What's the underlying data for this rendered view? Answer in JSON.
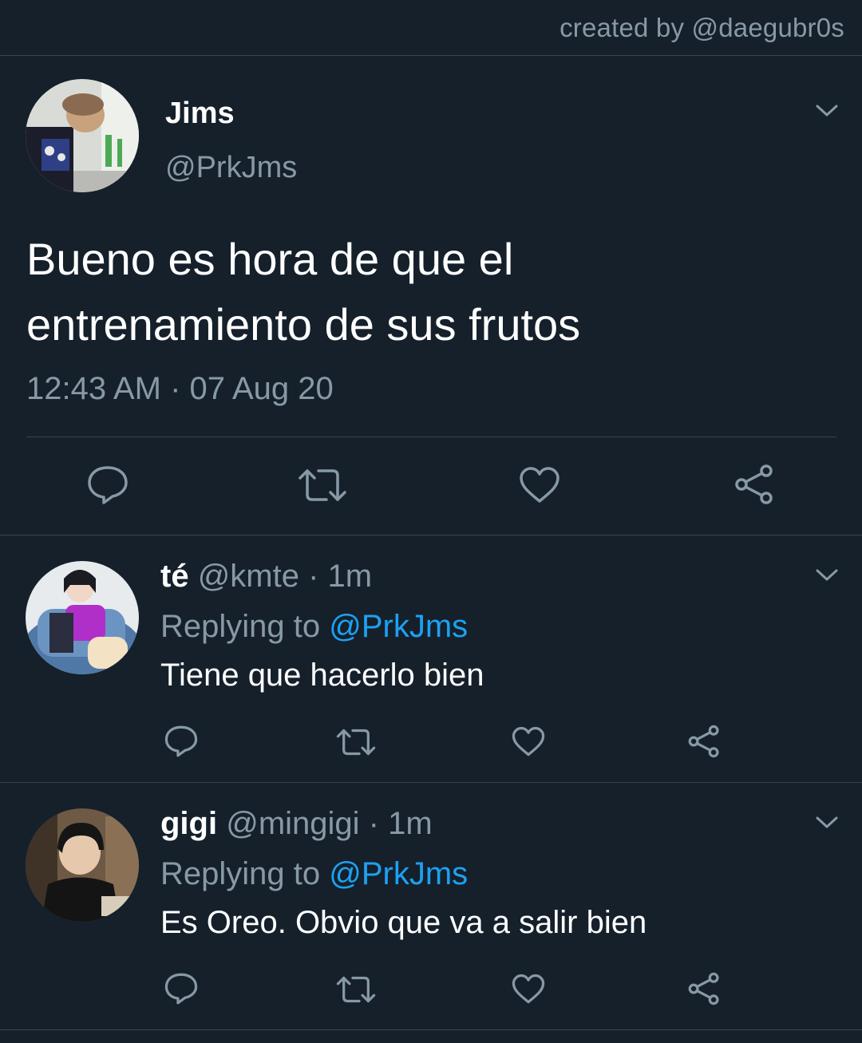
{
  "header": {
    "creator": "created by @daegubr0s"
  },
  "main_tweet": {
    "name": "Jims",
    "handle": "@PrkJms",
    "text": "Bueno es hora de que el entrenamiento de sus frutos",
    "timestamp": "12:43 AM · 07 Aug 20",
    "actions": [
      "reply-icon",
      "retweet-icon",
      "like-icon",
      "share-icon"
    ]
  },
  "replies": [
    {
      "name": "té",
      "meta": "@kmte · 1m",
      "replying_prefix": "Replying to ",
      "replying_handle": "@PrkJms",
      "text": "Tiene que hacerlo bien"
    },
    {
      "name": "gigi",
      "meta": "@mingigi · 1m",
      "replying_prefix": "Replying to ",
      "replying_handle": "@PrkJms",
      "text": "Es Oreo. Obvio que va a salir bien"
    }
  ],
  "colors": {
    "background": "#15202b",
    "secondary_text": "#8899a6",
    "link": "#1da1f2",
    "divider": "#38444d"
  }
}
